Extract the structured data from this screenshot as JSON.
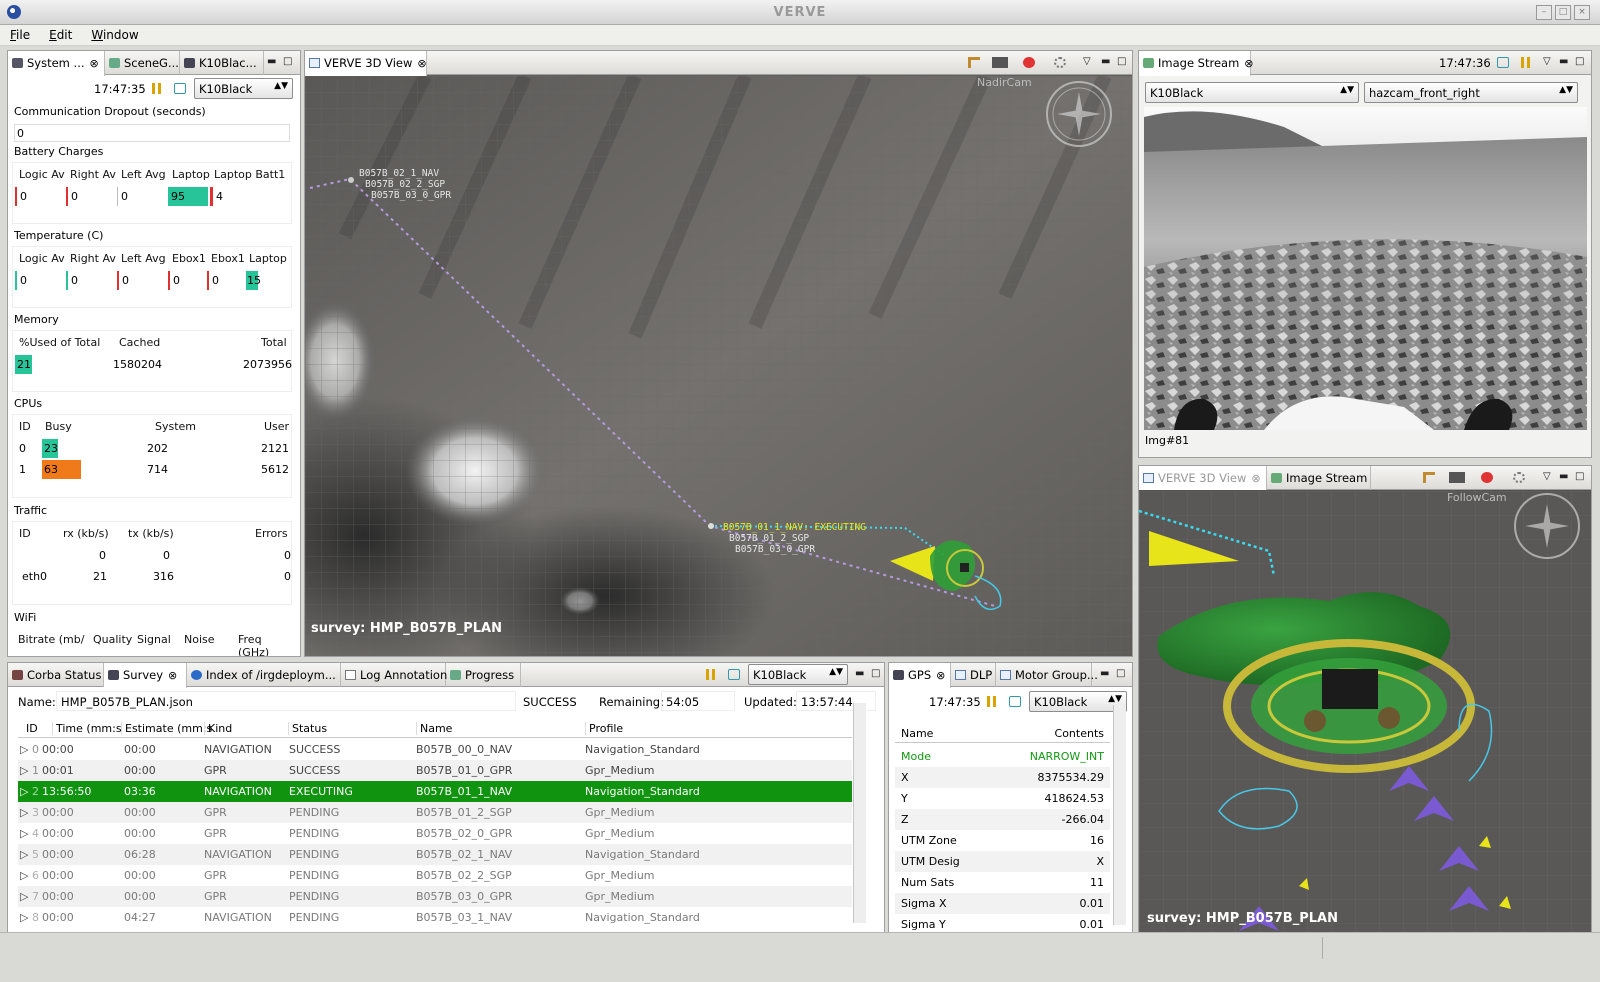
{
  "window": {
    "title": "VERVE"
  },
  "menu": [
    "File",
    "Edit",
    "Window"
  ],
  "system_panel": {
    "tabs": [
      "System ...",
      "SceneG...",
      "K10Blac..."
    ],
    "time": "17:47:35",
    "robot": "K10Black",
    "comm_label": "Communication Dropout (seconds)",
    "comm_value": "0",
    "battery": {
      "label": "Battery Charges",
      "headers": [
        "Logic Av",
        "Right Av",
        "Left Avg",
        "Laptop",
        "Laptop Batt1"
      ],
      "values": [
        "0",
        "0",
        "0",
        "95",
        "4"
      ]
    },
    "temperature": {
      "label": "Temperature (C)",
      "headers": [
        "Logic Av",
        "Right Av",
        "Left Avg",
        "Ebox1",
        "Ebox1",
        "Laptop"
      ],
      "values": [
        "0",
        "0",
        "0",
        "0",
        "0",
        "15"
      ]
    },
    "memory": {
      "label": "Memory",
      "headers": [
        "%Used of Total",
        "Cached",
        "Total"
      ],
      "values": [
        "21",
        "1580204",
        "2073956"
      ]
    },
    "cpus": {
      "label": "CPUs",
      "headers": [
        "ID",
        "Busy",
        "System",
        "User"
      ],
      "rows": [
        [
          "0",
          "23",
          "202",
          "2121"
        ],
        [
          "1",
          "63",
          "714",
          "5612"
        ]
      ]
    },
    "traffic": {
      "label": "Traffic",
      "headers": [
        "ID",
        "rx (kb/s)",
        "tx (kb/s)",
        "Errors"
      ],
      "rows": [
        [
          "",
          "0",
          "0",
          "0"
        ],
        [
          "eth0",
          "21",
          "316",
          "0"
        ]
      ]
    },
    "wifi": {
      "label": "WiFi",
      "headers": [
        "Bitrate (mb/",
        "Quality",
        "Signal",
        "Noise",
        "Freq (GHz)"
      ]
    },
    "colors": {
      "battery_high": "#27c49a",
      "battery_low": "#e03030",
      "cpu_low": "#27c49a",
      "cpu_mid": "#f07a1a"
    }
  },
  "view3d": {
    "tab": "VERVE 3D View",
    "cam_label": "NadirCam",
    "wp_far": [
      "B057B_02_1_NAV",
      "B057B_02_2_SGP",
      "B057B_03_0_GPR"
    ],
    "wp_near": [
      "B057B_01_1_NAV: EXECUTING",
      "B057B_01_2_SGP",
      "B057B_03_0_GPR"
    ],
    "survey_label": "survey: HMP_B057B_PLAN"
  },
  "image_stream": {
    "tab": "Image Stream",
    "time": "17:47:36",
    "robot": "K10Black",
    "camera": "hazcam_front_right",
    "img_label": "Img#81"
  },
  "follow_view": {
    "tabs": [
      "VERVE 3D View",
      "Image Stream"
    ],
    "cam_label": "FollowCam",
    "survey_label": "survey: HMP_B057B_PLAN"
  },
  "bottom_tabs": [
    "Corba Status",
    "Survey",
    "Index of /irgdeploym...",
    "Log Annotation",
    "Progress"
  ],
  "survey": {
    "robot": "K10Black",
    "name_label": "Name:",
    "name": "HMP_B057B_PLAN.json",
    "status": "SUCCESS",
    "remaining_label": "Remaining:",
    "remaining": "54:05",
    "updated_label": "Updated:",
    "updated": "13:57:44",
    "headers": [
      "ID",
      "Time (mm:s",
      "Estimate (mm:s",
      "Kind",
      "Status",
      "Name",
      "Profile"
    ],
    "rows": [
      {
        "id": "0",
        "time": "00:00",
        "est": "00:00",
        "kind": "NAVIGATION",
        "status": "SUCCESS",
        "name": "B057B_00_0_NAV",
        "profile": "Navigation_Standard",
        "state": "done"
      },
      {
        "id": "1",
        "time": "00:01",
        "est": "00:00",
        "kind": "GPR",
        "status": "SUCCESS",
        "name": "B057B_01_0_GPR",
        "profile": "Gpr_Medium",
        "state": "done"
      },
      {
        "id": "2",
        "time": "13:56:50",
        "est": "03:36",
        "kind": "NAVIGATION",
        "status": "EXECUTING",
        "name": "B057B_01_1_NAV",
        "profile": "Navigation_Standard",
        "state": "exec"
      },
      {
        "id": "3",
        "time": "00:00",
        "est": "00:00",
        "kind": "GPR",
        "status": "PENDING",
        "name": "B057B_01_2_SGP",
        "profile": "Gpr_Medium",
        "state": "pending"
      },
      {
        "id": "4",
        "time": "00:00",
        "est": "00:00",
        "kind": "GPR",
        "status": "PENDING",
        "name": "B057B_02_0_GPR",
        "profile": "Gpr_Medium",
        "state": "pending"
      },
      {
        "id": "5",
        "time": "00:00",
        "est": "06:28",
        "kind": "NAVIGATION",
        "status": "PENDING",
        "name": "B057B_02_1_NAV",
        "profile": "Navigation_Standard",
        "state": "pending"
      },
      {
        "id": "6",
        "time": "00:00",
        "est": "00:00",
        "kind": "GPR",
        "status": "PENDING",
        "name": "B057B_02_2_SGP",
        "profile": "Gpr_Medium",
        "state": "pending"
      },
      {
        "id": "7",
        "time": "00:00",
        "est": "00:00",
        "kind": "GPR",
        "status": "PENDING",
        "name": "B057B_03_0_GPR",
        "profile": "Gpr_Medium",
        "state": "pending"
      },
      {
        "id": "8",
        "time": "00:00",
        "est": "04:27",
        "kind": "NAVIGATION",
        "status": "PENDING",
        "name": "B057B_03_1_NAV",
        "profile": "Navigation_Standard",
        "state": "pending"
      }
    ]
  },
  "gps_tabs": [
    "GPS",
    "DLP",
    "Motor Group..."
  ],
  "gps": {
    "time": "17:47:35",
    "robot": "K10Black",
    "headers": [
      "Name",
      "Contents"
    ],
    "rows": [
      {
        "name": "Mode",
        "value": "NARROW_INT"
      },
      {
        "name": "X",
        "value": "8375534.29"
      },
      {
        "name": "Y",
        "value": "418624.53"
      },
      {
        "name": "Z",
        "value": "-266.04"
      },
      {
        "name": "UTM Zone",
        "value": "16"
      },
      {
        "name": "UTM Desig",
        "value": "X"
      },
      {
        "name": "Num Sats",
        "value": "11"
      },
      {
        "name": "Sigma X",
        "value": "0.01"
      },
      {
        "name": "Sigma Y",
        "value": "0.01"
      }
    ],
    "mode_color": "#119911"
  }
}
